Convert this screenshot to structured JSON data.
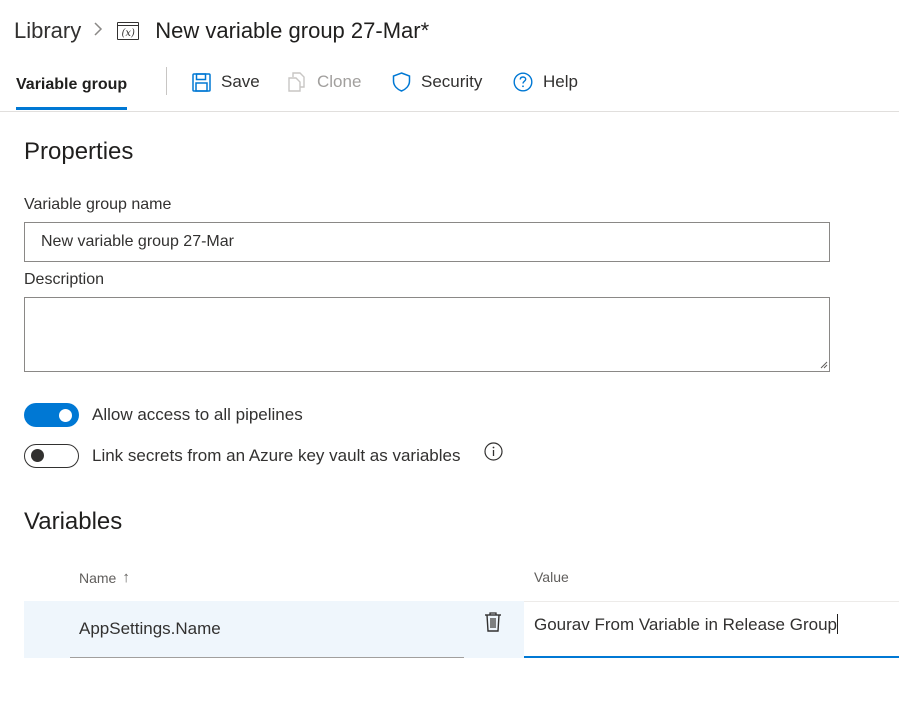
{
  "breadcrumb": {
    "root": "Library",
    "separator": ">",
    "icon": "variable-group-icon",
    "title": "New variable group 27-Mar*"
  },
  "toolbar": {
    "active_tab": "Variable group",
    "save_label": "Save",
    "clone_label": "Clone",
    "security_label": "Security",
    "help_label": "Help"
  },
  "properties": {
    "heading": "Properties",
    "name_label": "Variable group name",
    "name_value": "New variable group 27-Mar",
    "description_label": "Description",
    "description_value": ""
  },
  "toggles": {
    "allow_access_label": "Allow access to all pipelines",
    "allow_access_on": true,
    "link_secrets_label": "Link secrets from an Azure key vault as variables",
    "link_secrets_on": false
  },
  "variables": {
    "heading": "Variables",
    "name_header": "Name",
    "sort_indicator": "↑",
    "value_header": "Value",
    "rows": [
      {
        "name": "AppSettings.Name",
        "value": "Gourav From Variable in Release Group"
      }
    ]
  },
  "colors": {
    "accent": "#0078d4",
    "row_highlight": "#eff6fc"
  }
}
